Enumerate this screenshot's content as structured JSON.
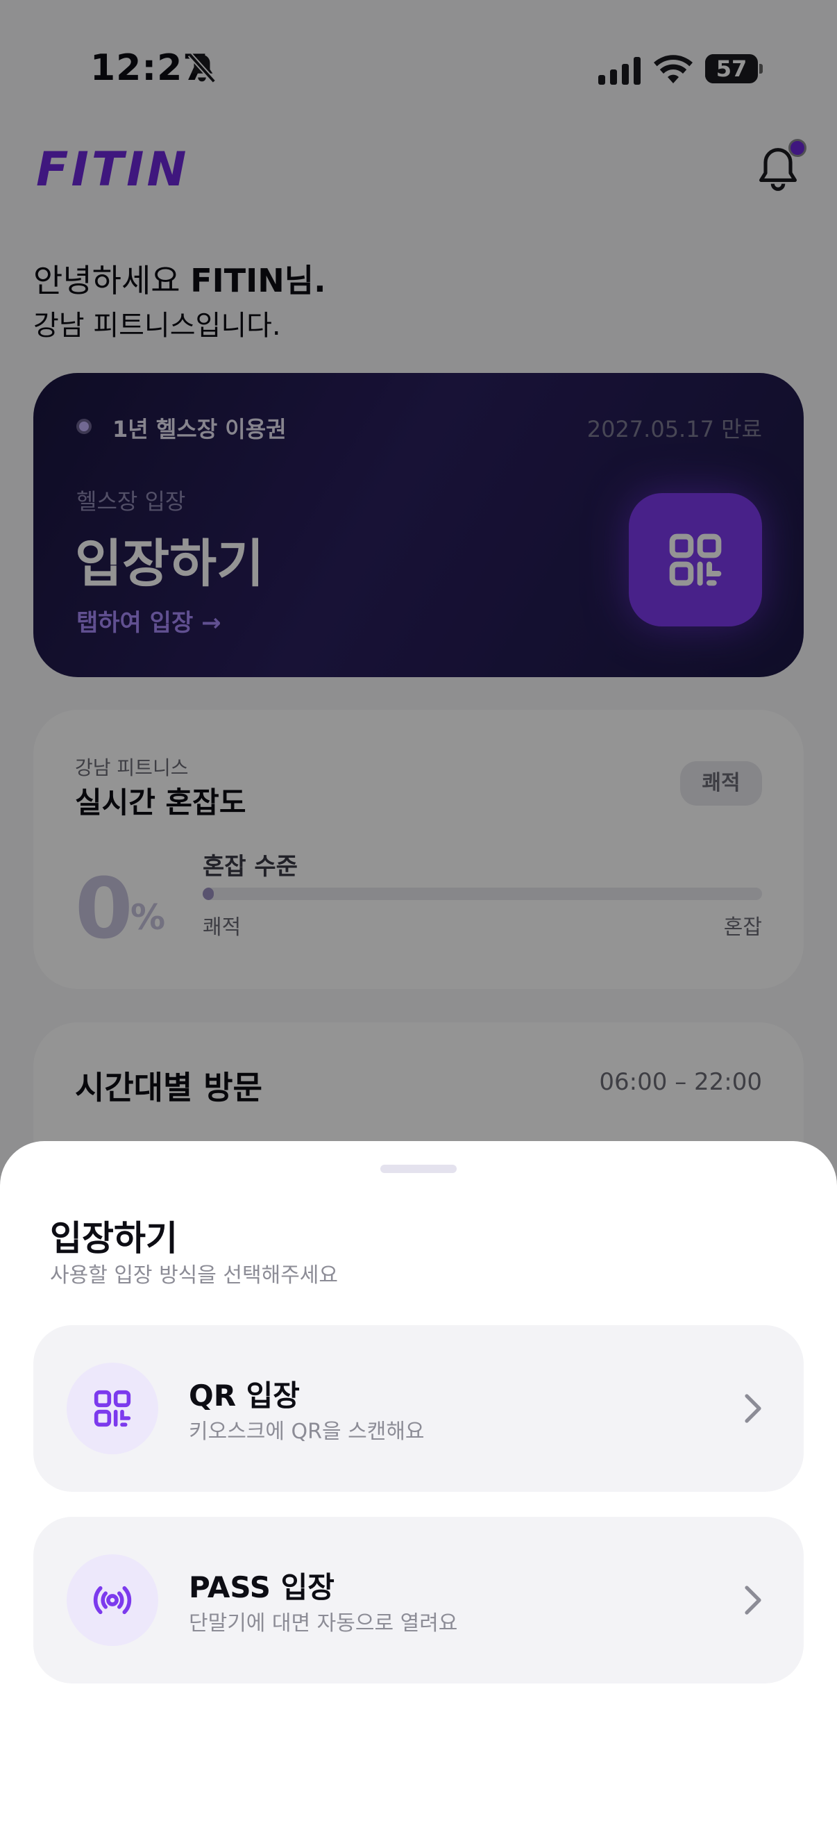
{
  "status_bar": {
    "time": "12:27",
    "battery": "57",
    "icons": [
      "bell-off-icon",
      "signal-icon",
      "wifi-icon",
      "battery-icon"
    ]
  },
  "header": {
    "logo": "FITIN",
    "notification_icon": "bell-icon"
  },
  "greeting": {
    "hello": "안녕하세요 ",
    "name": "FITIN님.",
    "gym_line": "강남 피트니스입니다."
  },
  "pass_card": {
    "pass_name": "1년 헬스장 이용권",
    "expiry": "2027.05.17 만료",
    "subtitle": "헬스장 입장",
    "title": "입장하기",
    "tap_hint": "탭하여 입장 →",
    "button_icon": "qr-code-icon"
  },
  "congestion": {
    "gym_name": "강남 피트니스",
    "title": "실시간 혼잡도",
    "badge": "쾌적",
    "value": "0",
    "unit": "%",
    "level_label": "혼잡 수준",
    "level_fraction": 0.02,
    "low_label": "쾌적",
    "high_label": "혼잡"
  },
  "visits": {
    "title": "시간대별 방문",
    "hours": "06:00 – 22:00"
  },
  "sheet": {
    "title": "입장하기",
    "subtitle": "사용할 입장 방식을 선택해주세요",
    "options": [
      {
        "title": "QR 입장",
        "desc": "키오스크에 QR을 스캔해요",
        "icon": "qr-code-icon"
      },
      {
        "title": "PASS 입장",
        "desc": "단말기에 대면 자동으로 열려요",
        "icon": "broadcast-icon"
      }
    ]
  },
  "colors": {
    "accent": "#7c3aed",
    "logo": "#6d28d9",
    "card_dark": "#1a1640",
    "sheet_bg": "#ffffff",
    "option_bg": "#f3f3f6"
  }
}
